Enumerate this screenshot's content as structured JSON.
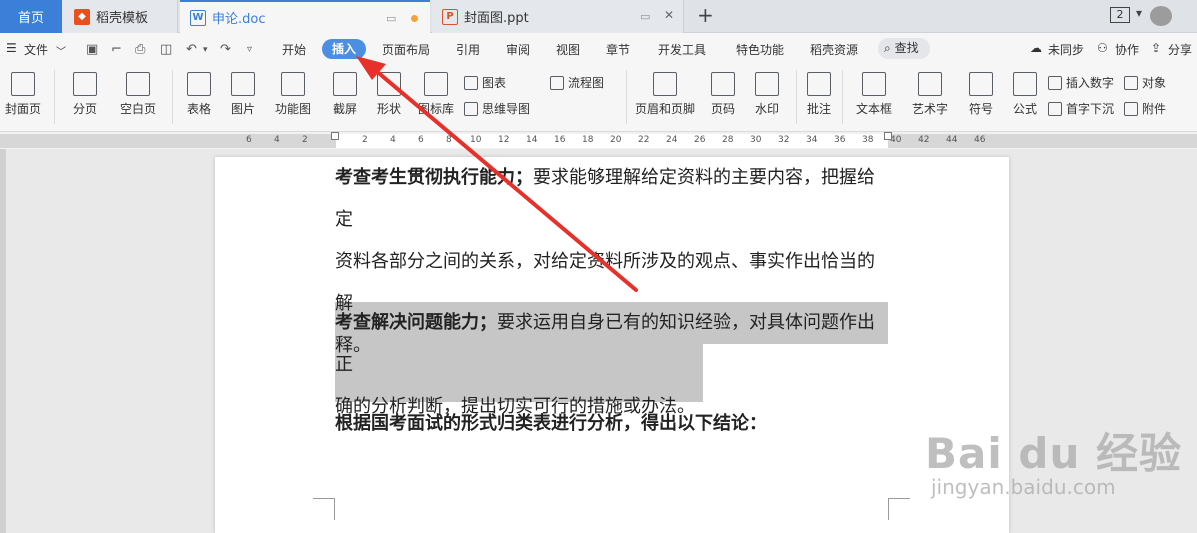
{
  "tabs": {
    "home": "首页",
    "daoke": "稻壳模板",
    "doc": "申论.doc",
    "ppt": "封面图.ppt"
  },
  "titlebar": {
    "page_count": "2"
  },
  "menu": {
    "file": "文件",
    "items": [
      "开始",
      "插入",
      "页面布局",
      "引用",
      "审阅",
      "视图",
      "章节",
      "开发工具",
      "特色功能",
      "稻壳资源"
    ],
    "active": "插入",
    "search": "查找",
    "unsynced": "未同步",
    "collab": "协作",
    "share": "分享"
  },
  "ribbon": {
    "cover": "封面页",
    "pagebreak": "分页",
    "blank": "空白页",
    "table": "表格",
    "picture": "图片",
    "funcgraph": "功能图",
    "screenshot": "截屏",
    "shape": "形状",
    "iconlib": "图标库",
    "chart": "图表",
    "flowchart": "流程图",
    "mindmap": "思维导图",
    "header_footer": "页眉和页脚",
    "pagenum": "页码",
    "watermark": "水印",
    "comment": "批注",
    "textbox": "文本框",
    "wordart": "艺术字",
    "symbol": "符号",
    "formula": "公式",
    "insert_number": "插入数字",
    "object": "对象",
    "dropcap": "首字下沉",
    "attachment": "附件"
  },
  "ruler": {
    "ticks": [
      "6",
      "4",
      "2",
      "2",
      "4",
      "6",
      "8",
      "10",
      "12",
      "14",
      "16",
      "18",
      "20",
      "22",
      "24",
      "26",
      "28",
      "30",
      "32",
      "34",
      "36",
      "38",
      "40",
      "42",
      "44",
      "46"
    ]
  },
  "document": {
    "p1_bold": "考查考生贯彻执行能力；",
    "p1_line1": "要求能够理解给定资料的主要内容，把握给定",
    "p1_line2": "资料各部分之间的关系，对给定资料所涉及的观点、事实作出恰当的解",
    "p1_line3": "释。",
    "p2_bold": "考查解决问题能力；",
    "p2_line1": "要求运用自身已有的知识经验，对具体问题作出正",
    "p2_line2": "确的分析判断，提出切实可行的措施或办法。",
    "p3_bold": "根据国考面试的形式归类表进行分析，得出以下结论："
  },
  "watermark": {
    "main": "Bai du 经验",
    "sub": "jingyan.baidu.com"
  },
  "colors": {
    "accent": "#3b7fd8",
    "active_pill": "#4b8fe3",
    "arrow": "#e8302a",
    "highlight": "#c6c6c6"
  }
}
